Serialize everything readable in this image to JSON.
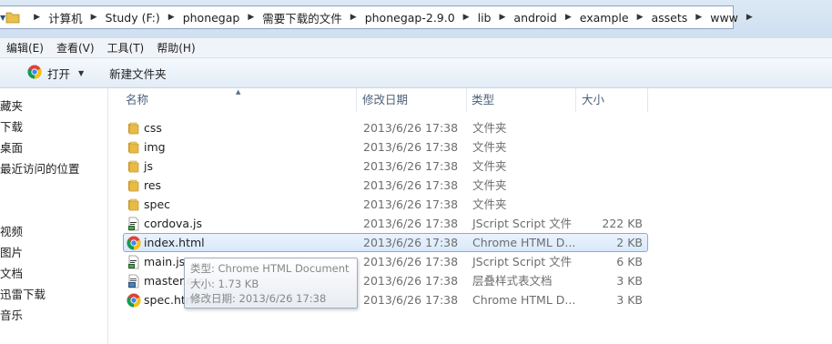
{
  "address_bar": {
    "crumbs": [
      "计算机",
      "Study (F:)",
      "phonegap",
      "需要下载的文件",
      "phonegap-2.9.0",
      "lib",
      "android",
      "example",
      "assets",
      "www"
    ]
  },
  "menu": {
    "items": [
      "编辑(E)",
      "查看(V)",
      "工具(T)",
      "帮助(H)"
    ]
  },
  "toolbar": {
    "open_label": "打开",
    "new_folder_label": "新建文件夹"
  },
  "nav_pane": {
    "items": [
      "藏夹",
      "下载",
      "桌面",
      "最近访问的位置",
      "视频",
      "图片",
      "文档",
      "迅雷下载",
      "音乐"
    ]
  },
  "columns": {
    "name": "名称",
    "date": "修改日期",
    "type": "类型",
    "size": "大小"
  },
  "files": [
    {
      "name": "css",
      "date": "2013/6/26 17:38",
      "type": "文件夹",
      "size": "",
      "icon": "folder-icon"
    },
    {
      "name": "img",
      "date": "2013/6/26 17:38",
      "type": "文件夹",
      "size": "",
      "icon": "folder-icon"
    },
    {
      "name": "js",
      "date": "2013/6/26 17:38",
      "type": "文件夹",
      "size": "",
      "icon": "folder-icon"
    },
    {
      "name": "res",
      "date": "2013/6/26 17:38",
      "type": "文件夹",
      "size": "",
      "icon": "folder-icon"
    },
    {
      "name": "spec",
      "date": "2013/6/26 17:38",
      "type": "文件夹",
      "size": "",
      "icon": "folder-icon"
    },
    {
      "name": "cordova.js",
      "date": "2013/6/26 17:38",
      "type": "JScript Script 文件",
      "size": "222 KB",
      "icon": "jscript-icon"
    },
    {
      "name": "index.html",
      "date": "2013/6/26 17:38",
      "type": "Chrome HTML D...",
      "size": "2 KB",
      "icon": "chrome-icon",
      "selected": true
    },
    {
      "name": "main.js",
      "date": "2013/6/26 17:38",
      "type": "JScript Script 文件",
      "size": "6 KB",
      "icon": "jscript-icon"
    },
    {
      "name": "master.css",
      "date": "2013/6/26 17:38",
      "type": "层叠样式表文档",
      "size": "3 KB",
      "icon": "css-icon"
    },
    {
      "name": "spec.html",
      "date": "2013/6/26 17:38",
      "type": "Chrome HTML D...",
      "size": "3 KB",
      "icon": "chrome-icon"
    }
  ],
  "tooltip": {
    "type_line": "类型: Chrome HTML Document",
    "size_line": "大小: 1.73 KB",
    "date_line": "修改日期: 2013/6/26 17:38"
  },
  "colors": {
    "selection_border": "#84acdd",
    "selection_fill": "#dbeafb",
    "folder": "#e8c04a",
    "header_text": "#4c607a"
  }
}
